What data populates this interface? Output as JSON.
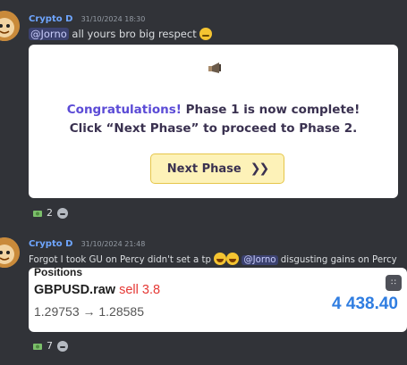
{
  "messages": [
    {
      "username": "Crypto D",
      "timestamp": "31/10/2024 18:30",
      "mention": "@Jorno",
      "text": " all yours bro big respect ",
      "emoji": "saluting-face"
    },
    {
      "username": "Crypto D",
      "timestamp": "31/10/2024 21:48",
      "text_before": "Forgot I took GU on Percy didn't set a tp ",
      "emoji": [
        "rolling-laughing-face",
        "rolling-laughing-face"
      ],
      "mention": "@Jorno",
      "text_after": " disgusting gains on Percy"
    }
  ],
  "embed": {
    "icon": "megaphone-icon",
    "accent_text": "Congratulations!",
    "body_text": " Phase 1 is now complete! Click “Next Phase” to proceed to Phase 2.",
    "button_label": "Next Phase",
    "button_arrow": "❯❯"
  },
  "reactions": [
    {
      "emoji": "money-icon",
      "count": "2"
    },
    {
      "emoji": "money-icon",
      "count": "7"
    }
  ],
  "position_card": {
    "title": "Positions",
    "symbol": "GBPUSD.raw",
    "side": "sell 3.8",
    "prices": "1.29753 → 1.28585",
    "profit": "4 438.40"
  },
  "colors": {
    "background": "#313338",
    "username": "#6fa6ff",
    "mention_bg": "#3c4270",
    "accent": "#5b4bd6",
    "sell": "#e53935",
    "profit": "#2f7de1"
  }
}
